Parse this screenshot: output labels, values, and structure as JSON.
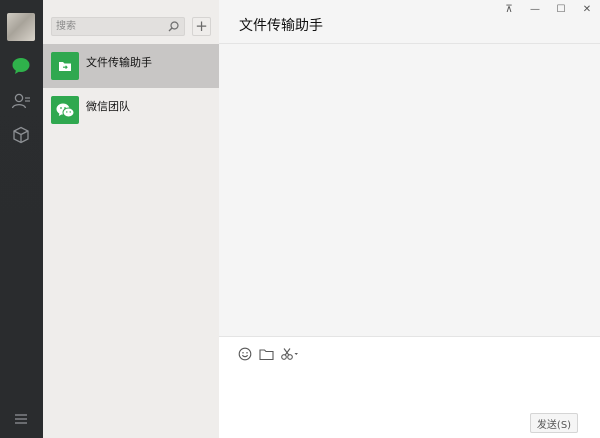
{
  "nav": {
    "items": [
      {
        "name": "chat-icon",
        "active": true
      },
      {
        "name": "contacts-icon",
        "active": false
      },
      {
        "name": "favorites-icon",
        "active": false
      }
    ],
    "menu_icon": "menu-icon"
  },
  "search": {
    "placeholder": "搜索",
    "icon": "search-icon",
    "add_label": "+"
  },
  "chats": [
    {
      "name": "文件传输助手",
      "icon": "file-transfer-icon",
      "active": true
    },
    {
      "name": "微信团队",
      "icon": "wechat-team-icon",
      "active": false
    }
  ],
  "window": {
    "pin_label": "⊼",
    "minimize_label": "—",
    "maximize_label": "☐",
    "close_label": "✕"
  },
  "conversation": {
    "title": "文件传输助手"
  },
  "composer": {
    "tools": [
      "emoji-icon",
      "folder-icon",
      "scissors-icon"
    ],
    "send_label": "发送(S)"
  },
  "colors": {
    "accent": "#2fa84f",
    "rail": "#2b2d2f",
    "list_bg": "#efedeb",
    "active_row": "#c8c6c5"
  }
}
